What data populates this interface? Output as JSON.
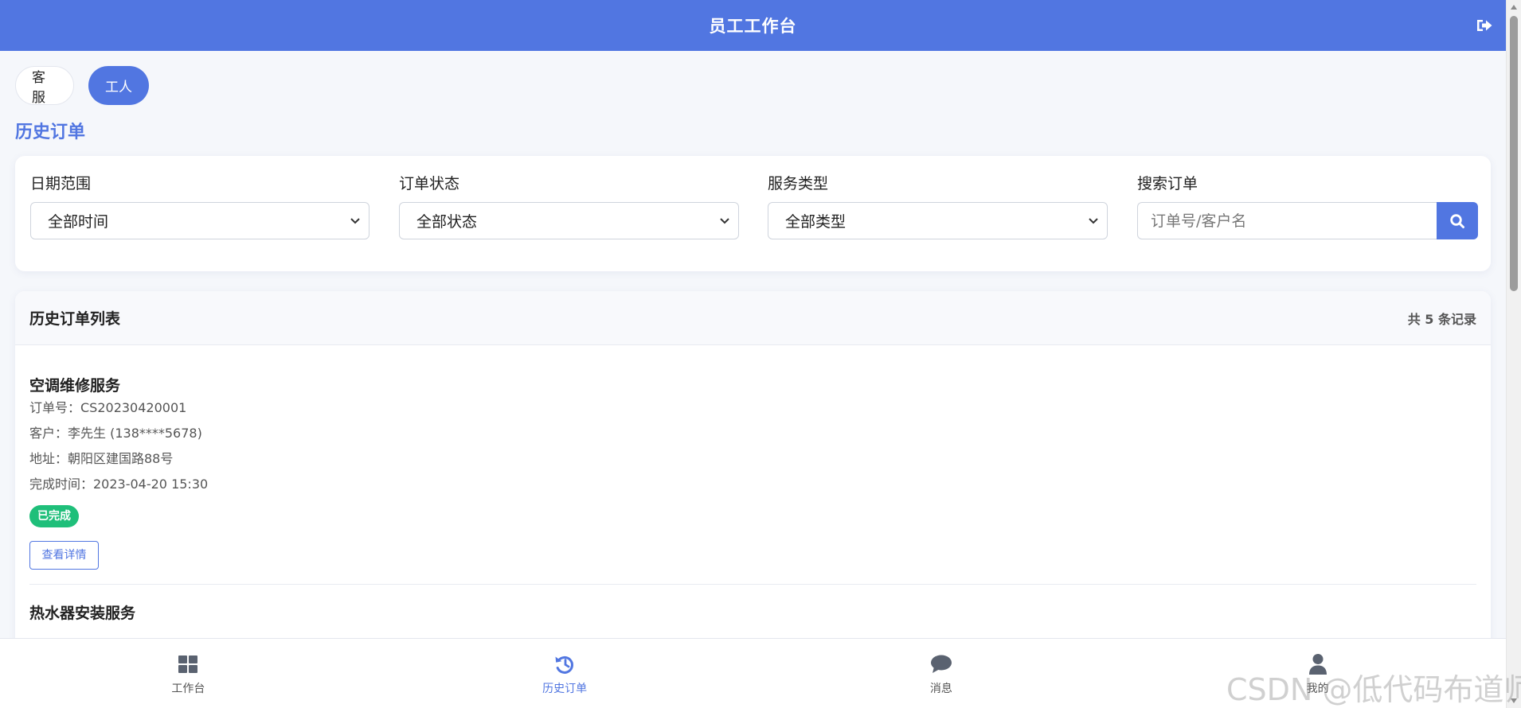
{
  "header": {
    "title": "员工工作台",
    "logout_icon": "sign-out-icon"
  },
  "roles": [
    {
      "label": "客服",
      "active": false
    },
    {
      "label": "工人",
      "active": true
    }
  ],
  "section_title": "历史订单",
  "filters": {
    "date": {
      "label": "日期范围",
      "value": "全部时间"
    },
    "status": {
      "label": "订单状态",
      "value": "全部状态"
    },
    "service": {
      "label": "服务类型",
      "value": "全部类型"
    },
    "search": {
      "label": "搜索订单",
      "placeholder": "订单号/客户名"
    }
  },
  "list": {
    "title": "历史订单列表",
    "count_text": "共 5 条记录",
    "orders": [
      {
        "title": "空调维修服务",
        "order_no": "订单号：CS20230420001",
        "customer": "客户：李先生 (138****5678)",
        "address": "地址：朝阳区建国路88号",
        "finish_time": "完成时间：2023-04-20 15:30",
        "status": "已完成",
        "status_color": "#1fbf7a",
        "action": "查看详情"
      },
      {
        "title": "热水器安装服务"
      }
    ]
  },
  "bottom_nav": [
    {
      "label": "工作台",
      "icon": "dashboard-icon",
      "active": false
    },
    {
      "label": "历史订单",
      "icon": "history-icon",
      "active": true
    },
    {
      "label": "消息",
      "icon": "chat-bubble-icon",
      "active": false
    },
    {
      "label": "我的",
      "icon": "user-icon",
      "active": false
    }
  ],
  "watermark": "CSDN @低代码布道师",
  "colors": {
    "accent": "#5176e1",
    "success": "#1fbf7a",
    "background": "#f5f7fb"
  }
}
